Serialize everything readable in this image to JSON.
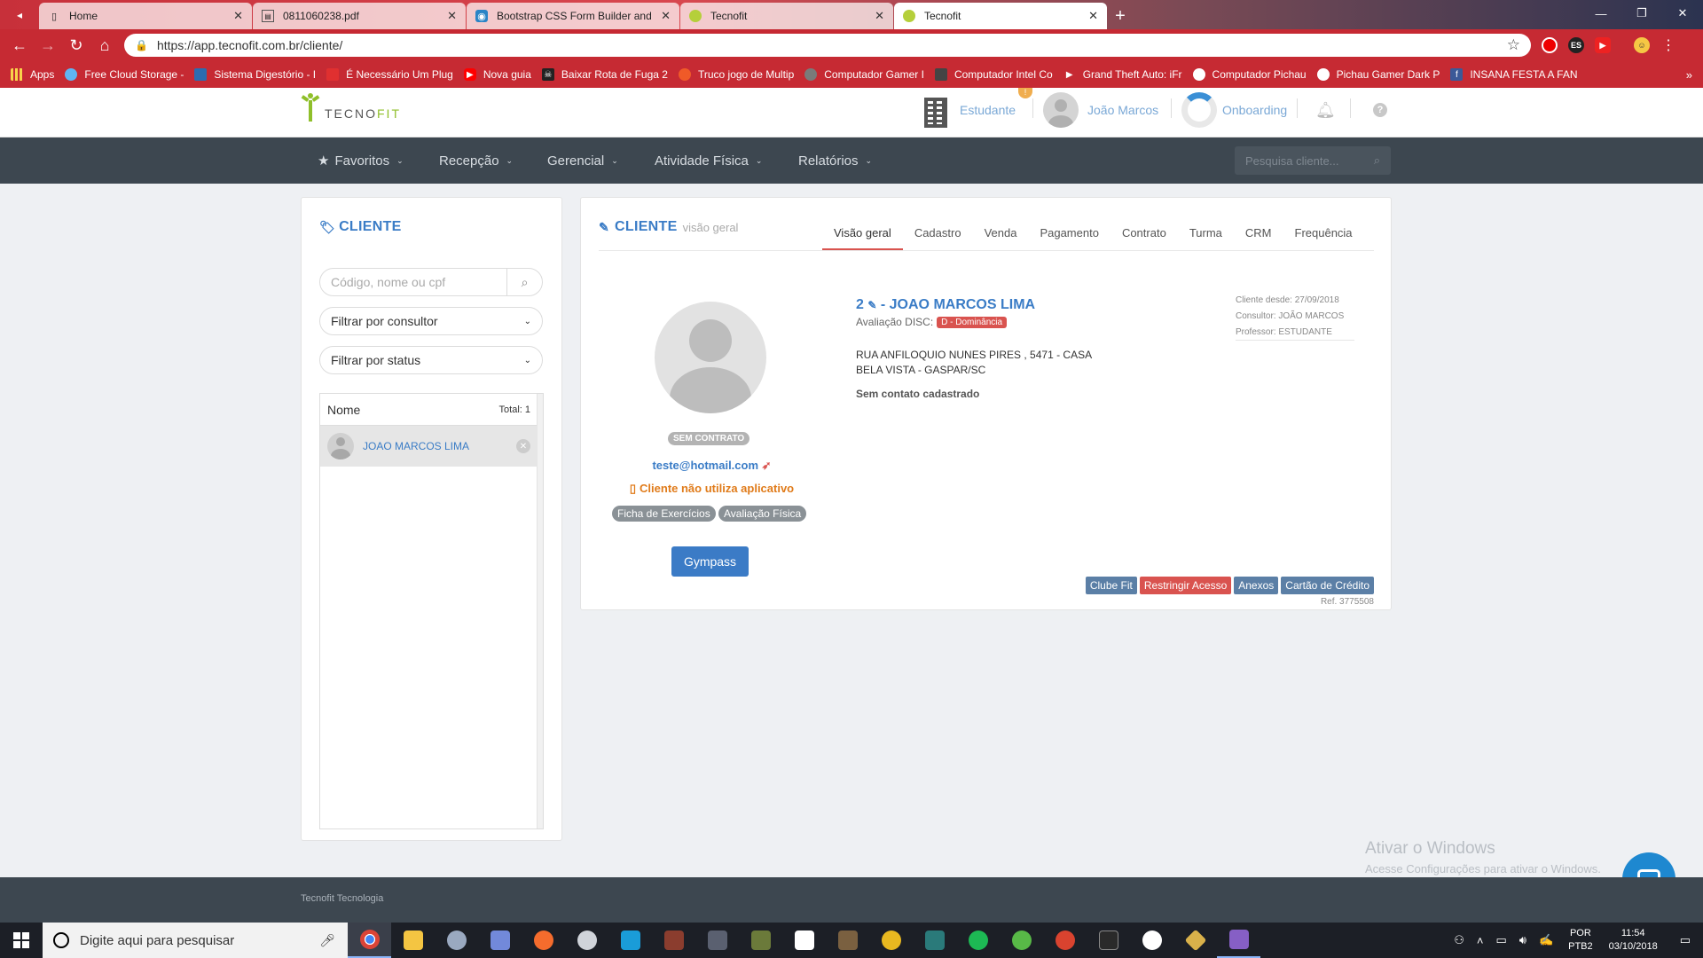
{
  "browser": {
    "tabs": [
      {
        "title": "Home",
        "icon": "page-icon"
      },
      {
        "title": "0811060238.pdf",
        "icon": "pdf-icon"
      },
      {
        "title": "Bootstrap CSS Form Builder and",
        "icon": "eye-icon"
      },
      {
        "title": "Tecnofit",
        "icon": "tecnofit-icon"
      },
      {
        "title": "Tecnofit",
        "icon": "tecnofit-icon"
      }
    ],
    "url": "https://app.tecnofit.com.br/cliente/",
    "extension_label": "ES",
    "bookmarks": [
      "Apps",
      "Free Cloud Storage -",
      "Sistema Digestório - I",
      "É Necessário Um Plug",
      "Nova guia",
      "Baixar Rota de Fuga 2",
      "Truco jogo de Multip",
      "Computador Gamer I",
      "Computador Intel Co",
      "Grand Theft Auto: iFr",
      "Computador Pichau",
      "Pichau Gamer Dark P",
      "INSANA FESTA A FAN"
    ],
    "bookmarks_more": "»"
  },
  "header": {
    "logo_a": "TECNO",
    "logo_b": "FIT",
    "unit": "Estudante",
    "user": "João Marcos",
    "onboarding": "Onboarding",
    "badge_count": "!"
  },
  "nav": {
    "items": [
      "Favoritos",
      "Recepção",
      "Gerencial",
      "Atividade Física",
      "Relatórios"
    ],
    "search_placeholder": "Pesquisa cliente..."
  },
  "left": {
    "title": "CLIENTE",
    "search_placeholder": "Código, nome ou cpf",
    "filter_consultor": "Filtrar por consultor",
    "filter_status": "Filtrar por status",
    "list_header": "Nome",
    "list_total": "Total: 1",
    "clients": [
      {
        "name": "JOAO MARCOS LIMA"
      }
    ]
  },
  "main": {
    "title": "CLIENTE",
    "subtitle": "visão geral",
    "tabs": [
      "Visão geral",
      "Cadastro",
      "Venda",
      "Pagamento",
      "Contrato",
      "Turma",
      "CRM",
      "Frequência"
    ],
    "active_tab": "Visão geral",
    "status_badge": "SEM CONTRATO",
    "email": "teste@hotmail.com",
    "app_status": "Cliente não utiliza aplicativo",
    "tags": [
      "Ficha de Exercícios",
      "Avaliação Física"
    ],
    "gympass": "Gympass",
    "client_code": "2",
    "client_name": "- JOAO MARCOS LIMA",
    "disc_label": "Avaliação DISC:",
    "disc_value": "D - Dominância",
    "address1": "RUA ANFILOQUIO NUNES PIRES , 5471 - CASA",
    "address2": "BELA VISTA - GASPAR/SC",
    "no_contact": "Sem contato cadastrado",
    "client_since": "Cliente desde: 27/09/2018",
    "consultant": "Consultor: JOÃO MARCOS",
    "teacher": "Professor: ESTUDANTE",
    "actions": [
      {
        "label": "Clube Fit",
        "color": "#5b7fa6"
      },
      {
        "label": "Restringir Acesso",
        "color": "#d9534f"
      },
      {
        "label": "Anexos",
        "color": "#5b7fa6"
      },
      {
        "label": "Cartão de Crédito",
        "color": "#5b7fa6"
      }
    ],
    "ref": "Ref. 3775508"
  },
  "watermark": {
    "line1": "Ativar o Windows",
    "line2": "Acesse Configurações para ativar o Windows."
  },
  "footer": {
    "text": "Tecnofit Tecnologia"
  },
  "taskbar": {
    "search_placeholder": "Digite aqui para pesquisar",
    "lang1": "POR",
    "lang2": "PTB2",
    "time": "11:54",
    "date": "03/10/2018"
  },
  "colors": {
    "accent_blue": "#3a7cc6",
    "nav_bg": "#3d4750",
    "brand_green": "#8fbf2a",
    "browser_red": "#c62a33"
  }
}
